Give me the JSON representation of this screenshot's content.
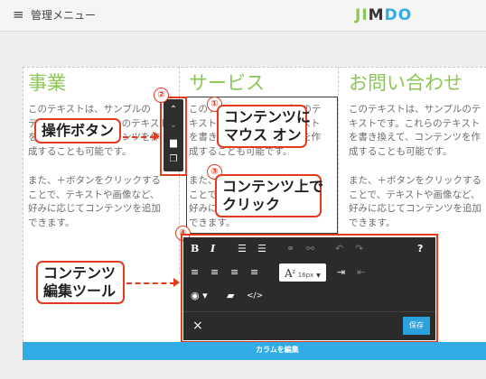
{
  "header": {
    "menu_icon": "hamburger-icon",
    "menu_label": "管理メニュー",
    "logo": {
      "letters": [
        "J",
        "I",
        "M",
        "D",
        "O"
      ],
      "colors": [
        "#8cc654",
        "#8cc654",
        "#333333",
        "#32ace5",
        "#32ace5"
      ]
    }
  },
  "columns": [
    {
      "title": "事業",
      "paragraph1": "このテキストは、サンプルの\nテキストです。これらのテキスト\nを書き換えて、コンテンツを作\n成することも可能です。",
      "paragraph2": "また、＋ボタンをクリックする\nことで、テキストや画像など、\n好みに応じてコンテンツを追加\nできます。"
    },
    {
      "title": "サービス",
      "paragraph1": "このテキストは、サンプルのテ\nキストです。これらのテキスト\nを書き換えて、コンテンツを作\n成することも可能です。",
      "paragraph2": "また、＋ボタンをクリックする\nことで、テキストや画像など、\n好みに応じてコンテンツを追加\nできます。"
    },
    {
      "title": "お問い合わせ",
      "paragraph1": "このテキストは、サンプルのテ\nキストです。これらのテキスト\nを書き換えて、コンテンツを作\n成することも可能です。",
      "paragraph2": "また、＋ボタンをクリックする\nことで、テキストや画像など、\n好みに応じてコンテンツを追加\nできます。"
    }
  ],
  "column_bar_label": "カラムを編集",
  "operation_toolbar": {
    "icons": [
      "chevron-up-icon",
      "chevron-down-icon",
      "trash-icon",
      "duplicate-icon"
    ]
  },
  "annotations": {
    "num1": "①",
    "num2": "②",
    "num3": "③",
    "num4": "④",
    "callout_operation": "操作ボタン",
    "callout_hover": "コンテンツに\nマウス オン",
    "callout_click": "コンテンツ上で\nクリック",
    "callout_editor": "コンテンツ\n編集ツール"
  },
  "editor": {
    "bold": "B",
    "italic": "I",
    "help": "?",
    "font_size_value": "16px",
    "close_label": "×",
    "save_label": "保存",
    "font_size_icon_text": "A",
    "font_size_icon_sup": "z"
  },
  "colors": {
    "accent_green": "#8cc654",
    "annotation_red": "#e23b1e",
    "save_blue": "#2aa2de",
    "editor_bg": "#2b2b2b"
  }
}
